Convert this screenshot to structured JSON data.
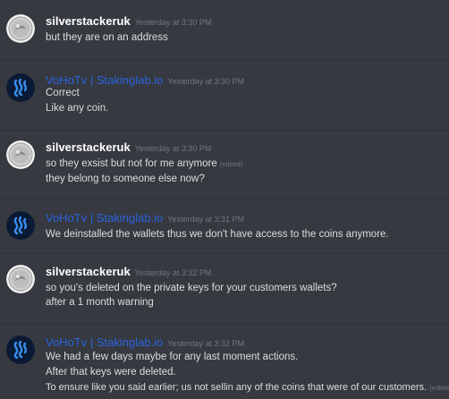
{
  "colors": {
    "background": "#36393f",
    "silverstacker_name": "#ffffff",
    "voho_name": "#2b63e0",
    "timestamp": "#72767d",
    "text": "#dcddde",
    "voho_avatar_bg": "#0a1a34",
    "voho_avatar_logo": "#3a8ef0"
  },
  "messages": [
    {
      "author": "silverstackeruk",
      "avatar": "silver-coin-avatar",
      "timestamp": "Yesterday at 3:30 PM",
      "lines": [
        "but they are on an address"
      ]
    },
    {
      "author": "VoHoTv | Stakinglab.io",
      "avatar": "steem-logo-avatar",
      "timestamp": "Yesterday at 3:30 PM",
      "lines": [
        "Correct",
        "Like any coin."
      ]
    },
    {
      "author": "silverstackeruk",
      "avatar": "silver-coin-avatar",
      "timestamp": "Yesterday at 3:30 PM",
      "lines": [
        "so they exsist but not for me anymore",
        "they belong to someone else now?"
      ],
      "edited_label": "(edited)"
    },
    {
      "author": "VoHoTv | Stakinglab.io",
      "avatar": "steem-logo-avatar",
      "timestamp": "Yesterday at 3:31 PM",
      "lines": [
        "We deinstalled the wallets thus we don't have access to the coins anymore."
      ]
    },
    {
      "author": "silverstackeruk",
      "avatar": "silver-coin-avatar",
      "timestamp": "Yesterday at 3:32 PM",
      "lines": [
        "so you's deleted on the private keys for your customers wallets?",
        "after a 1 month warning"
      ]
    },
    {
      "author": "VoHoTv | Stakinglab.io",
      "avatar": "steem-logo-avatar",
      "timestamp": "Yesterday at 3:32 PM",
      "lines": [
        "We had a few days maybe for any last moment actions.",
        "After that keys were deleted.",
        "To ensure like you said earlier; us not sellin any of the coins that were of our customers."
      ],
      "edited_label": "(edited)"
    }
  ]
}
